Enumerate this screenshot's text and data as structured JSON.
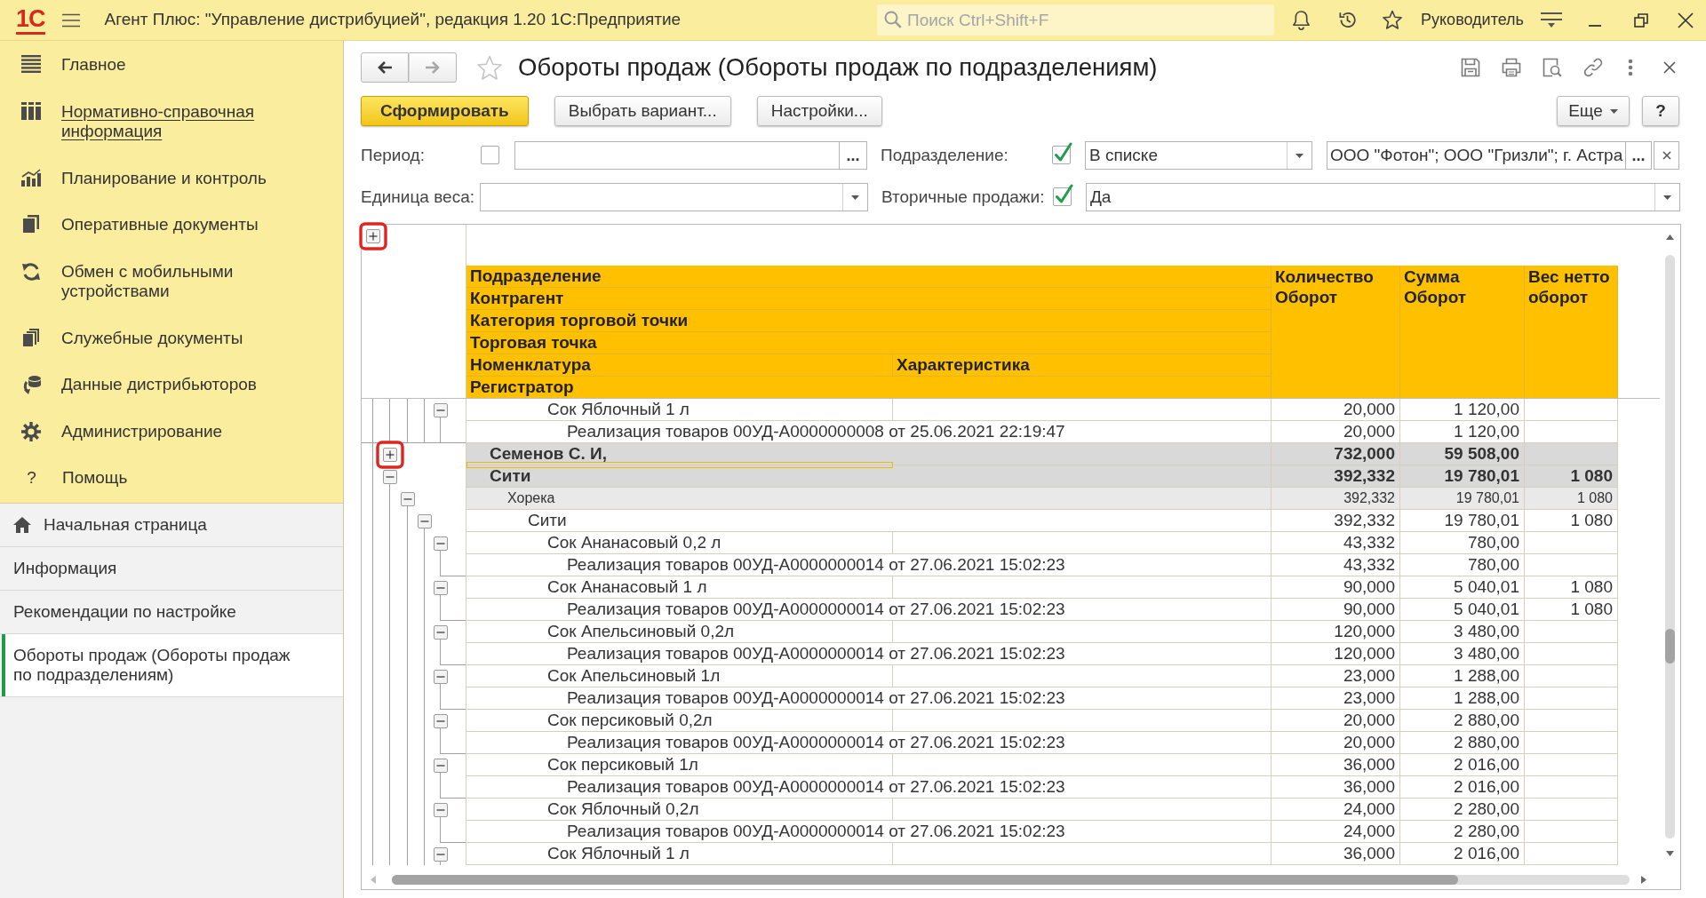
{
  "app_bar": {
    "logo": "1С",
    "title": "Агент Плюс: \"Управление дистрибуцией\", редакция 1.20 1С:Предприятие",
    "search": {
      "placeholder": "Поиск Ctrl+Shift+F"
    },
    "user": "Руководитель"
  },
  "sections": [
    {
      "label": "Главное",
      "hovered": false
    },
    {
      "label": "Нормативно-справочная информация",
      "hovered": true
    },
    {
      "label": "Планирование и контроль",
      "hovered": false
    },
    {
      "label": "Оперативные документы",
      "hovered": false
    },
    {
      "label": "Обмен с мобильными устройствами",
      "hovered": false
    },
    {
      "label": "Служебные документы",
      "hovered": false
    },
    {
      "label": "Данные дистрибьюторов",
      "hovered": false
    },
    {
      "label": "Администрирование",
      "hovered": false
    },
    {
      "label": "Помощь",
      "glyph": "?",
      "hovered": false
    }
  ],
  "open_windows": [
    {
      "kind": "home",
      "label": "Начальная страница",
      "selected": false
    },
    {
      "kind": "page",
      "label": "Информация",
      "selected": false
    },
    {
      "kind": "page",
      "label": "Рекомендации по настройке",
      "selected": false
    },
    {
      "kind": "page",
      "label": "Обороты продаж (Обороты продаж по подразделениям)",
      "selected": true
    }
  ],
  "form": {
    "title": "Обороты продаж (Обороты продаж по подразделениям)",
    "favorite": false,
    "nav": [
      {
        "kind": "back",
        "disabled": false
      },
      {
        "kind": "forward",
        "disabled": true
      }
    ],
    "buttons": [
      {
        "kind": "primary",
        "label": "Сформировать"
      },
      {
        "kind": "normal",
        "label": "Выбрать вариант..."
      },
      {
        "kind": "normal",
        "label": "Настройки..."
      }
    ],
    "more_button": "Еще",
    "help_button": "?",
    "filters": [
      {
        "kind": "period",
        "label": "Период:",
        "checked": false,
        "choose": "..."
      },
      {
        "kind": "list",
        "label": "Подразделение:",
        "checked": true,
        "condition": "В списке",
        "value": "ООО \"Фотон\"; ООО \"Гризли\"; г. Астра",
        "choose": "..."
      },
      {
        "kind": "select",
        "label": "Единица веса:"
      },
      {
        "kind": "flag",
        "label": "Вторичные продажи:",
        "checked": true,
        "value": "Да"
      }
    ]
  },
  "report": {
    "expand_all": {
      "expanded": false,
      "marked": true
    },
    "header": {
      "levels": [
        {
          "label": "Подразделение"
        },
        {
          "label": "Контрагент"
        },
        {
          "label": "Категория торговой точки"
        },
        {
          "label": "Торговая точка"
        },
        {
          "label": "Номенклатура",
          "second": "Характеристика"
        },
        {
          "label": "Регистратор"
        }
      ],
      "columns": [
        {
          "lines": [
            "Количество",
            "Оборот"
          ]
        },
        {
          "lines": [
            "Сумма",
            "Оборот"
          ]
        },
        {
          "lines": [
            "Вес нетто",
            "оборот"
          ]
        }
      ]
    },
    "rows": [
      {
        "kind": "item",
        "text": "Сок Яблочный 1 л",
        "quantity": "20,000",
        "sum": "1 120,00",
        "expanded": true,
        "marked": false,
        "current": false,
        "children": [
          {
            "kind": "registrar",
            "text": "Реализация товаров 00УД-А0000000008 от 25.06.2021 22:19:47",
            "quantity": "20,000",
            "sum": "1 120,00"
          }
        ]
      },
      {
        "kind": "division",
        "text": "Семенов С. И,",
        "quantity": "732,000",
        "sum": "59 508,00",
        "expanded": false,
        "marked": true,
        "current": true
      },
      {
        "kind": "counterparty",
        "text": "Сити",
        "quantity": "392,332",
        "sum": "19 780,01",
        "weight": "1 080",
        "expanded": true,
        "marked": false,
        "current": false,
        "children": [
          {
            "kind": "category",
            "text": "Хорека",
            "quantity": "392,332",
            "sum": "19 780,01",
            "weight": "1 080",
            "expanded": true,
            "children": [
              {
                "kind": "outlet",
                "text": "Сити",
                "quantity": "392,332",
                "sum": "19 780,01",
                "weight": "1 080",
                "expanded": true,
                "children": [
                  {
                    "kind": "item",
                    "text": "Сок Ананасовый 0,2 л",
                    "quantity": "43,332",
                    "sum": "780,00",
                    "expanded": true,
                    "children": [
                      {
                        "kind": "registrar",
                        "text": "Реализация товаров 00УД-А0000000014 от 27.06.2021 15:02:23",
                        "quantity": "43,332",
                        "sum": "780,00"
                      }
                    ]
                  },
                  {
                    "kind": "item",
                    "text": "Сок Ананасовый 1 л",
                    "quantity": "90,000",
                    "sum": "5 040,01",
                    "weight": "1 080",
                    "expanded": true,
                    "children": [
                      {
                        "kind": "registrar",
                        "text": "Реализация товаров 00УД-А0000000014 от 27.06.2021 15:02:23",
                        "quantity": "90,000",
                        "sum": "5 040,01",
                        "weight": "1 080"
                      }
                    ]
                  },
                  {
                    "kind": "item",
                    "text": "Сок Апельсиновый 0,2л",
                    "quantity": "120,000",
                    "sum": "3 480,00",
                    "expanded": true,
                    "children": [
                      {
                        "kind": "registrar",
                        "text": "Реализация товаров 00УД-А0000000014 от 27.06.2021 15:02:23",
                        "quantity": "120,000",
                        "sum": "3 480,00"
                      }
                    ]
                  },
                  {
                    "kind": "item",
                    "text": "Сок Апельсиновый 1л",
                    "quantity": "23,000",
                    "sum": "1 288,00",
                    "expanded": true,
                    "children": [
                      {
                        "kind": "registrar",
                        "text": "Реализация товаров 00УД-А0000000014 от 27.06.2021 15:02:23",
                        "quantity": "23,000",
                        "sum": "1 288,00"
                      }
                    ]
                  },
                  {
                    "kind": "item",
                    "text": "Сок персиковый 0,2л",
                    "quantity": "20,000",
                    "sum": "2 880,00",
                    "expanded": true,
                    "children": [
                      {
                        "kind": "registrar",
                        "text": "Реализация товаров 00УД-А0000000014 от 27.06.2021 15:02:23",
                        "quantity": "20,000",
                        "sum": "2 880,00"
                      }
                    ]
                  },
                  {
                    "kind": "item",
                    "text": "Сок персиковый 1л",
                    "quantity": "36,000",
                    "sum": "2 016,00",
                    "expanded": true,
                    "children": [
                      {
                        "kind": "registrar",
                        "text": "Реализация товаров 00УД-А0000000014 от 27.06.2021 15:02:23",
                        "quantity": "36,000",
                        "sum": "2 016,00"
                      }
                    ]
                  },
                  {
                    "kind": "item",
                    "text": "Сок Яблочный 0,2л",
                    "quantity": "24,000",
                    "sum": "2 280,00",
                    "expanded": true,
                    "children": [
                      {
                        "kind": "registrar",
                        "text": "Реализация товаров 00УД-А0000000014 от 27.06.2021 15:02:23",
                        "quantity": "24,000",
                        "sum": "2 280,00"
                      }
                    ]
                  },
                  {
                    "kind": "item",
                    "text": "Сок Яблочный 1 л",
                    "quantity": "36,000",
                    "sum": "2 016,00",
                    "expanded": true
                  }
                ]
              }
            ]
          }
        ]
      }
    ]
  }
}
